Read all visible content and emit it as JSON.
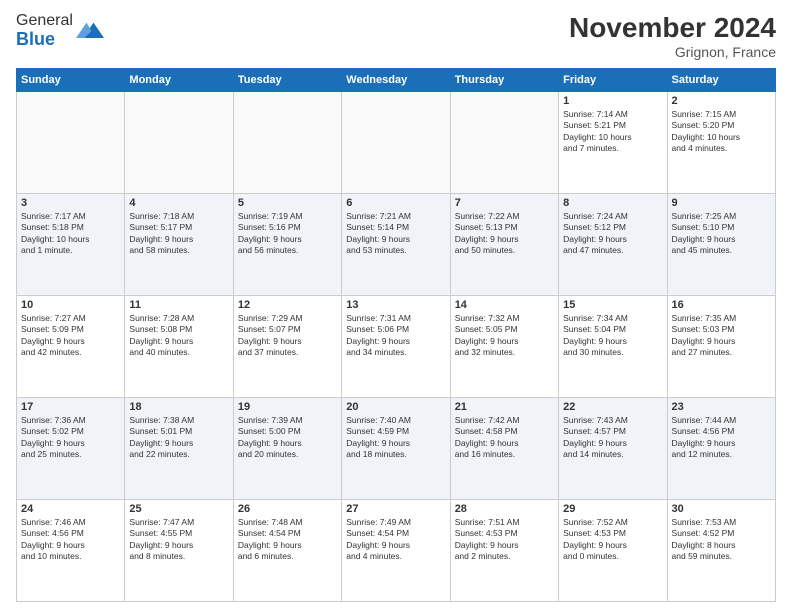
{
  "header": {
    "logo_line1": "General",
    "logo_line2": "Blue",
    "month": "November 2024",
    "location": "Grignon, France"
  },
  "weekdays": [
    "Sunday",
    "Monday",
    "Tuesday",
    "Wednesday",
    "Thursday",
    "Friday",
    "Saturday"
  ],
  "weeks": [
    [
      {
        "day": "",
        "info": ""
      },
      {
        "day": "",
        "info": ""
      },
      {
        "day": "",
        "info": ""
      },
      {
        "day": "",
        "info": ""
      },
      {
        "day": "",
        "info": ""
      },
      {
        "day": "1",
        "info": "Sunrise: 7:14 AM\nSunset: 5:21 PM\nDaylight: 10 hours\nand 7 minutes."
      },
      {
        "day": "2",
        "info": "Sunrise: 7:15 AM\nSunset: 5:20 PM\nDaylight: 10 hours\nand 4 minutes."
      }
    ],
    [
      {
        "day": "3",
        "info": "Sunrise: 7:17 AM\nSunset: 5:18 PM\nDaylight: 10 hours\nand 1 minute."
      },
      {
        "day": "4",
        "info": "Sunrise: 7:18 AM\nSunset: 5:17 PM\nDaylight: 9 hours\nand 58 minutes."
      },
      {
        "day": "5",
        "info": "Sunrise: 7:19 AM\nSunset: 5:16 PM\nDaylight: 9 hours\nand 56 minutes."
      },
      {
        "day": "6",
        "info": "Sunrise: 7:21 AM\nSunset: 5:14 PM\nDaylight: 9 hours\nand 53 minutes."
      },
      {
        "day": "7",
        "info": "Sunrise: 7:22 AM\nSunset: 5:13 PM\nDaylight: 9 hours\nand 50 minutes."
      },
      {
        "day": "8",
        "info": "Sunrise: 7:24 AM\nSunset: 5:12 PM\nDaylight: 9 hours\nand 47 minutes."
      },
      {
        "day": "9",
        "info": "Sunrise: 7:25 AM\nSunset: 5:10 PM\nDaylight: 9 hours\nand 45 minutes."
      }
    ],
    [
      {
        "day": "10",
        "info": "Sunrise: 7:27 AM\nSunset: 5:09 PM\nDaylight: 9 hours\nand 42 minutes."
      },
      {
        "day": "11",
        "info": "Sunrise: 7:28 AM\nSunset: 5:08 PM\nDaylight: 9 hours\nand 40 minutes."
      },
      {
        "day": "12",
        "info": "Sunrise: 7:29 AM\nSunset: 5:07 PM\nDaylight: 9 hours\nand 37 minutes."
      },
      {
        "day": "13",
        "info": "Sunrise: 7:31 AM\nSunset: 5:06 PM\nDaylight: 9 hours\nand 34 minutes."
      },
      {
        "day": "14",
        "info": "Sunrise: 7:32 AM\nSunset: 5:05 PM\nDaylight: 9 hours\nand 32 minutes."
      },
      {
        "day": "15",
        "info": "Sunrise: 7:34 AM\nSunset: 5:04 PM\nDaylight: 9 hours\nand 30 minutes."
      },
      {
        "day": "16",
        "info": "Sunrise: 7:35 AM\nSunset: 5:03 PM\nDaylight: 9 hours\nand 27 minutes."
      }
    ],
    [
      {
        "day": "17",
        "info": "Sunrise: 7:36 AM\nSunset: 5:02 PM\nDaylight: 9 hours\nand 25 minutes."
      },
      {
        "day": "18",
        "info": "Sunrise: 7:38 AM\nSunset: 5:01 PM\nDaylight: 9 hours\nand 22 minutes."
      },
      {
        "day": "19",
        "info": "Sunrise: 7:39 AM\nSunset: 5:00 PM\nDaylight: 9 hours\nand 20 minutes."
      },
      {
        "day": "20",
        "info": "Sunrise: 7:40 AM\nSunset: 4:59 PM\nDaylight: 9 hours\nand 18 minutes."
      },
      {
        "day": "21",
        "info": "Sunrise: 7:42 AM\nSunset: 4:58 PM\nDaylight: 9 hours\nand 16 minutes."
      },
      {
        "day": "22",
        "info": "Sunrise: 7:43 AM\nSunset: 4:57 PM\nDaylight: 9 hours\nand 14 minutes."
      },
      {
        "day": "23",
        "info": "Sunrise: 7:44 AM\nSunset: 4:56 PM\nDaylight: 9 hours\nand 12 minutes."
      }
    ],
    [
      {
        "day": "24",
        "info": "Sunrise: 7:46 AM\nSunset: 4:56 PM\nDaylight: 9 hours\nand 10 minutes."
      },
      {
        "day": "25",
        "info": "Sunrise: 7:47 AM\nSunset: 4:55 PM\nDaylight: 9 hours\nand 8 minutes."
      },
      {
        "day": "26",
        "info": "Sunrise: 7:48 AM\nSunset: 4:54 PM\nDaylight: 9 hours\nand 6 minutes."
      },
      {
        "day": "27",
        "info": "Sunrise: 7:49 AM\nSunset: 4:54 PM\nDaylight: 9 hours\nand 4 minutes."
      },
      {
        "day": "28",
        "info": "Sunrise: 7:51 AM\nSunset: 4:53 PM\nDaylight: 9 hours\nand 2 minutes."
      },
      {
        "day": "29",
        "info": "Sunrise: 7:52 AM\nSunset: 4:53 PM\nDaylight: 9 hours\nand 0 minutes."
      },
      {
        "day": "30",
        "info": "Sunrise: 7:53 AM\nSunset: 4:52 PM\nDaylight: 8 hours\nand 59 minutes."
      }
    ]
  ]
}
